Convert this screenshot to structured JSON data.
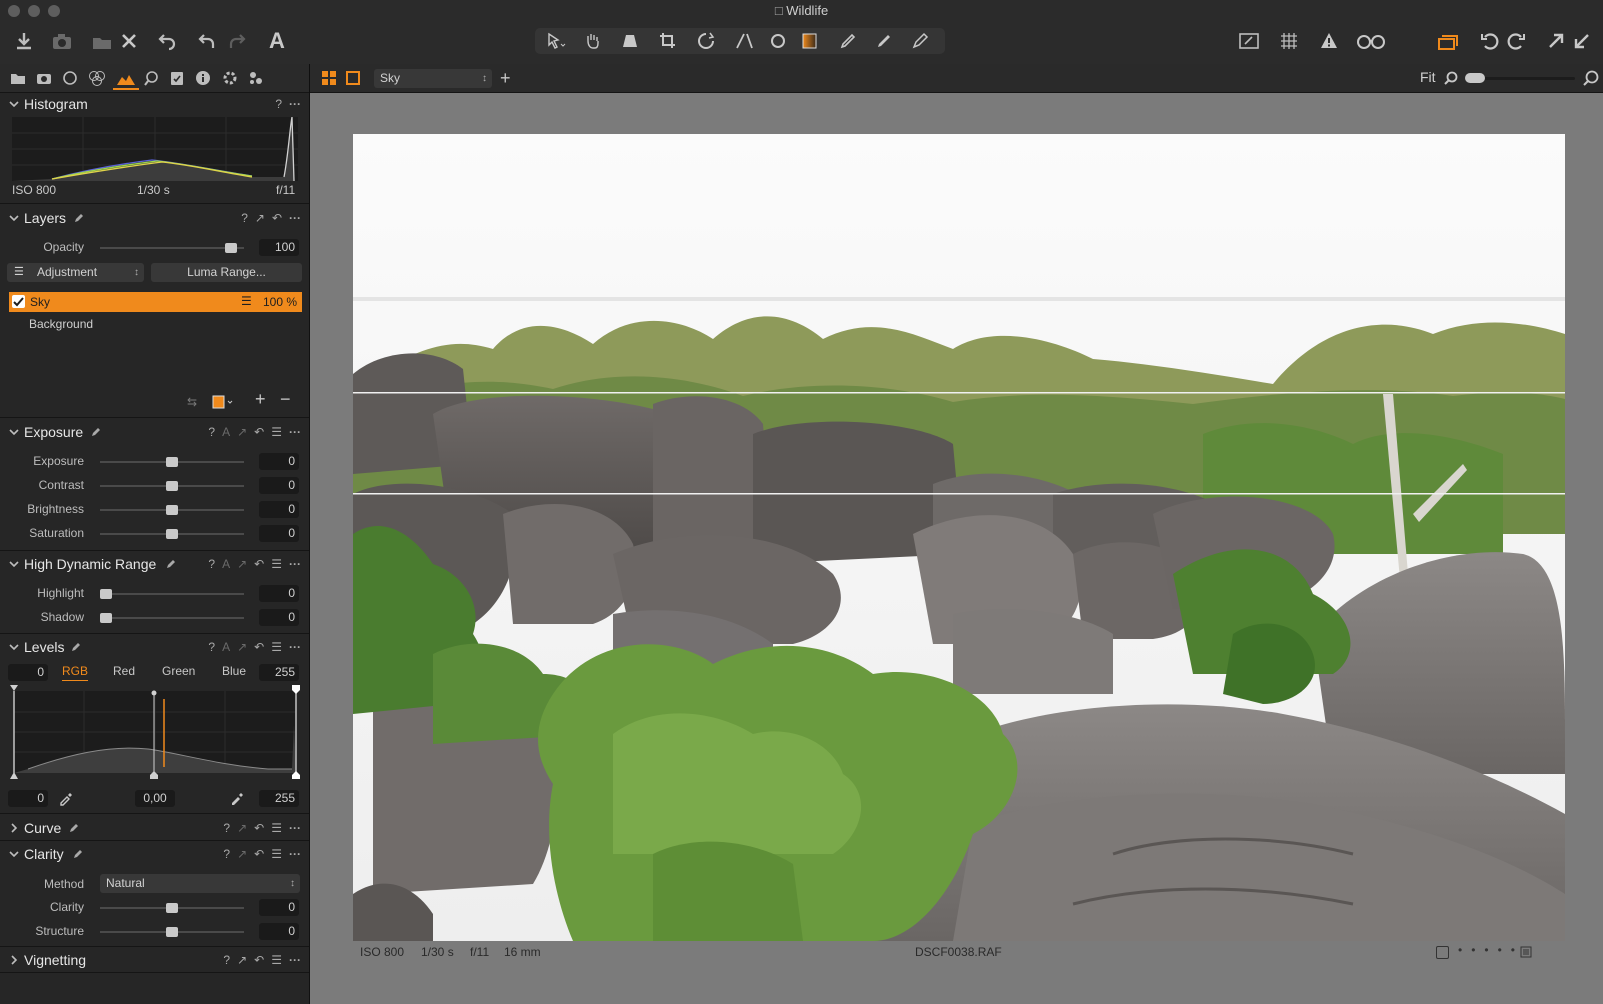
{
  "window": {
    "title": "Wildlife"
  },
  "toolbar": {
    "left_icons": [
      "import-icon",
      "camera-icon",
      "move-to-trash-icon",
      "delete-icon",
      "undo-all-icon",
      "undo-icon",
      "redo-icon",
      "text-icon"
    ],
    "center_icons": [
      "select-cursor-icon",
      "pan-hand-icon",
      "keystone-icon",
      "crop-icon",
      "rotate-icon",
      "straighten-icon",
      "circle-icon",
      "gradient-mask-icon",
      "draw-mask-icon",
      "erase-mask-icon",
      "annotate-icon"
    ],
    "right_icons": [
      "edit-icon",
      "grid-icon",
      "warning-icon",
      "glasses-icon",
      "variants-icon",
      "rotate-left-icon",
      "rotate-right-icon",
      "expand-icon",
      "collapse-icon"
    ]
  },
  "tool_tabs": [
    "library-tab",
    "capture-tab",
    "lens-tab",
    "color-tab",
    "exposure-tab",
    "details-tab",
    "adjustments-tab",
    "metadata-tab",
    "output-tab",
    "batch-tab"
  ],
  "viewer_header": {
    "layer_select": "Sky",
    "fit_label": "Fit"
  },
  "histogram": {
    "title": "Histogram",
    "iso": "ISO 800",
    "shutter": "1/30 s",
    "aperture": "f/11"
  },
  "layers": {
    "title": "Layers",
    "opacity_label": "Opacity",
    "opacity_value": "100",
    "opacity_level": 0.95,
    "adjustment_select": "Adjustment",
    "luma_button": "Luma Range...",
    "items": [
      {
        "name": "Sky",
        "value": "100 %",
        "selected": true
      },
      {
        "name": "Background",
        "value": "",
        "selected": false
      }
    ]
  },
  "exposure": {
    "title": "Exposure",
    "sliders": [
      {
        "label": "Exposure",
        "value": "0",
        "level": 0.5
      },
      {
        "label": "Contrast",
        "value": "0",
        "level": 0.5
      },
      {
        "label": "Brightness",
        "value": "0",
        "level": 0.5
      },
      {
        "label": "Saturation",
        "value": "0",
        "level": 0.5
      }
    ]
  },
  "hdr": {
    "title": "High Dynamic Range",
    "sliders": [
      {
        "label": "Highlight",
        "value": "0",
        "level": 0.0
      },
      {
        "label": "Shadow",
        "value": "0",
        "level": 0.0
      }
    ]
  },
  "levels": {
    "title": "Levels",
    "min_value": "0",
    "max_value": "255",
    "channels": [
      "RGB",
      "Red",
      "Green",
      "Blue"
    ],
    "active_channel": "RGB",
    "out_min": "0",
    "midtone": "0,00",
    "out_max": "255"
  },
  "curve": {
    "title": "Curve"
  },
  "clarity": {
    "title": "Clarity",
    "method_label": "Method",
    "method_value": "Natural",
    "sliders": [
      {
        "label": "Clarity",
        "value": "0",
        "level": 0.5
      },
      {
        "label": "Structure",
        "value": "0",
        "level": 0.5
      }
    ]
  },
  "vignetting": {
    "title": "Vignetting"
  },
  "image_caption": {
    "iso": "ISO 800",
    "shutter": "1/30 s",
    "aperture": "f/11",
    "focal": "16 mm",
    "filename": "DSCF0038.RAF"
  },
  "colors": {
    "accent": "#f08a1c",
    "panel": "#262626",
    "viewer": "#7b7b7b"
  }
}
